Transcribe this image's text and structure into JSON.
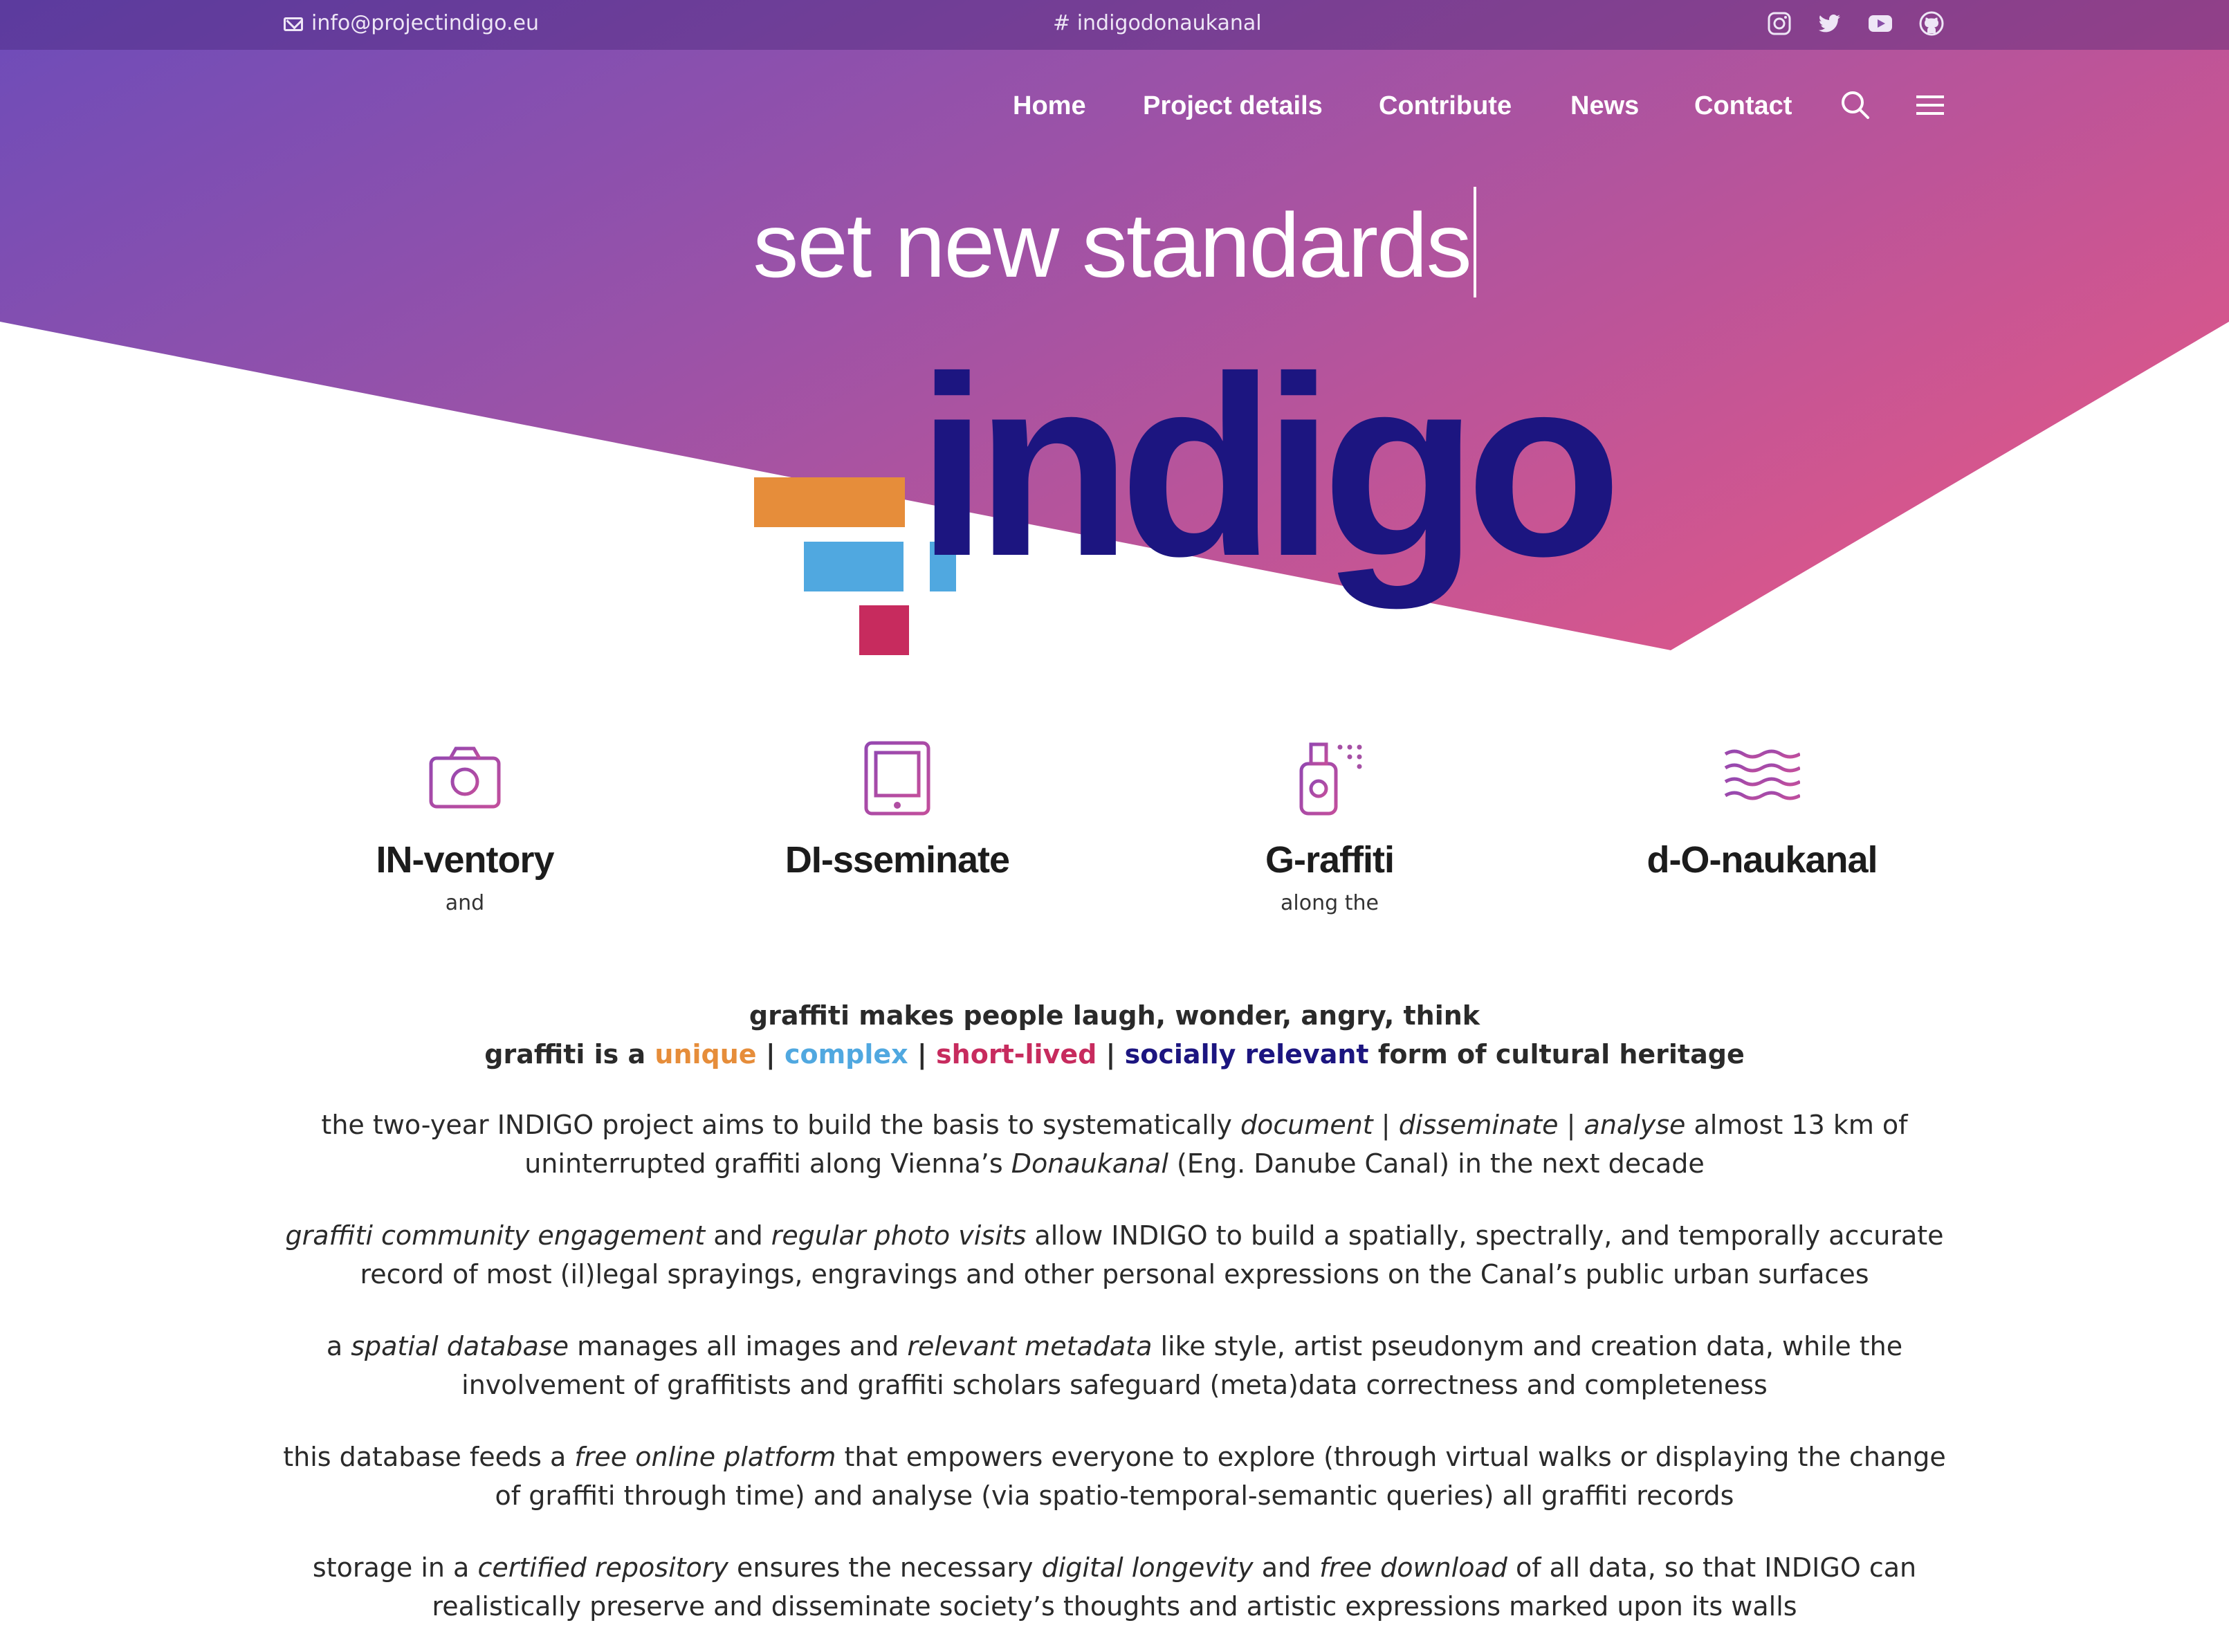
{
  "topbar": {
    "email": "info@projectindigo.eu",
    "hashtag": "indigodonaukanal",
    "social_icons": [
      "instagram-icon",
      "twitter-icon",
      "youtube-icon",
      "github-icon"
    ]
  },
  "nav": {
    "items": [
      "Home",
      "Project details",
      "Contribute",
      "News",
      "Contact"
    ],
    "icons": [
      "search-icon",
      "menu-icon"
    ]
  },
  "hero": {
    "headline": "set new standards"
  },
  "logo": {
    "wordmark": "indigo",
    "colors": {
      "orange": "#e68d3a",
      "blue": "#50a8e0",
      "red": "#c72b5e",
      "navy": "#1c1580"
    }
  },
  "features": [
    {
      "icon": "camera-icon",
      "title": "IN-ventory",
      "subtitle": "and"
    },
    {
      "icon": "tablet-icon",
      "title": "DI-sseminate",
      "subtitle": ""
    },
    {
      "icon": "spray-can-icon",
      "title": "G-raffiti",
      "subtitle": "along the"
    },
    {
      "icon": "waves-icon",
      "title": "d-O-naukanal",
      "subtitle": ""
    }
  ],
  "intro": {
    "line1": "graffiti makes people laugh, wonder, angry, think",
    "line2_prefix": "graffiti is a",
    "adj_unique": "unique",
    "adj_complex": "complex",
    "adj_short_lived": "short-lived",
    "adj_socially_relevant": "socially relevant",
    "separator": "|",
    "line2_suffix": "form of cultural heritage"
  },
  "paragraphs": {
    "p1": {
      "a": "the two-year INDIGO project aims to build the basis to systematically ",
      "b": "document",
      "c": " | ",
      "d": "disseminate",
      "e": " | ",
      "f": "analyse",
      "g": " almost 13 km of uninterrupted graffiti along Vienna’s ",
      "h": "Donaukanal",
      "i": " (Eng. Danube Canal) in the next decade"
    },
    "p2": {
      "a": "graffiti community engagement",
      "b": " and ",
      "c": "regular photo visits",
      "d": " allow INDIGO to build a spatially, spectrally, and temporally accurate record of most (il)legal sprayings, engravings and other personal expressions  on the Canal’s public urban surfaces"
    },
    "p3": {
      "a": "a ",
      "b": "spatial database",
      "c": " manages all images and ",
      "d": "relevant metadata",
      "e": " like style, artist pseudonym and creation data, while the involvement of graffitists and graffiti scholars safeguard (meta)data correctness and completeness"
    },
    "p4": {
      "a": "this database feeds a ",
      "b": "free online platform",
      "c": " that empowers everyone to explore (through virtual walks or displaying the change of graffiti through time) and analyse (via spatio-temporal-semantic queries) all graffiti records"
    },
    "p5": {
      "a": "storage in a ",
      "b": "certified repository",
      "c": " ensures the necessary ",
      "d": "digital longevity",
      "e": " and ",
      "f": "free download",
      "g": " of all data, so that INDIGO can realistically preserve and disseminate society’s thoughts and artistic expressions marked upon its walls"
    }
  },
  "theme": {
    "gradient_start": "#6b4bb8",
    "gradient_end": "#d2568f",
    "icon_gradient_start": "#9548b0",
    "icon_gradient_end": "#c24e9c"
  }
}
